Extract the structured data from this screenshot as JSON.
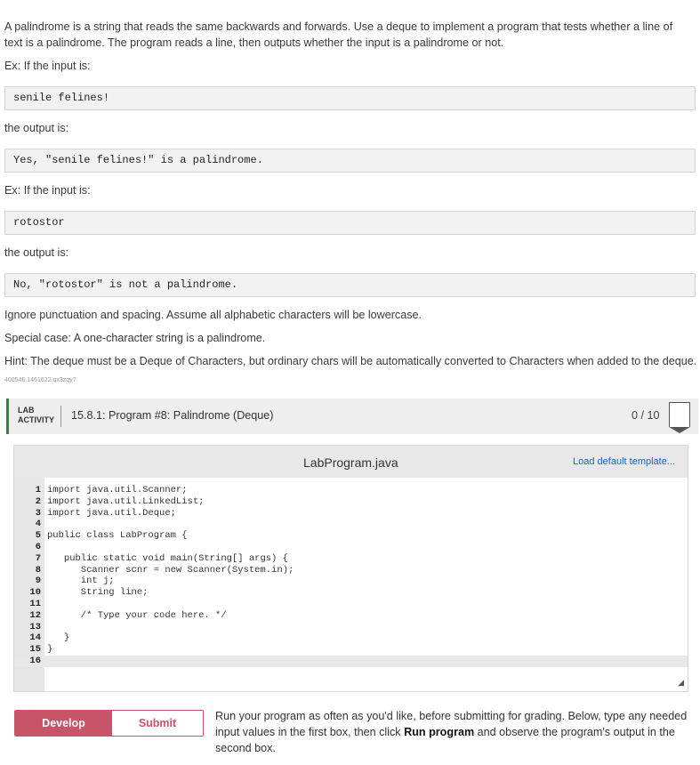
{
  "prompt": {
    "intro": "A palindrome is a string that reads the same backwards and forwards. Use a deque to implement a program that tests whether a line of text is a palindrome. The program reads a line, then outputs whether the input is a palindrome or not.",
    "ex1_label": "Ex: If the input is:",
    "ex1_input": "senile felines!",
    "output_label_1": "the output is:",
    "ex1_output": "Yes, \"senile felines!\" is a palindrome.",
    "ex2_label": "Ex: If the input is:",
    "ex2_input": "rotostor",
    "output_label_2": "the output is:",
    "ex2_output": "No, \"rotostor\" is not a palindrome.",
    "note1": "Ignore punctuation and spacing. Assume all alphabetic characters will be lowercase.",
    "note2": "Special case: A one-character string is a palindrome.",
    "hint": "Hint: The deque must be a Deque of Characters, but ordinary chars will be automatically converted to Characters when added to the deque.",
    "tracking_id": "400546.1461622.qx3zqy7"
  },
  "lab": {
    "tag": "LAB ACTIVITY",
    "title": "15.8.1: Program #8: Palindrome (Deque)",
    "score": "0 / 10"
  },
  "editor": {
    "file_name": "LabProgram.java",
    "load_template": "Load default template...",
    "lines": [
      {
        "n": "1",
        "code": "import java.util.Scanner;"
      },
      {
        "n": "2",
        "code": "import java.util.LinkedList;"
      },
      {
        "n": "3",
        "code": "import java.util.Deque;"
      },
      {
        "n": "4",
        "code": ""
      },
      {
        "n": "5",
        "code": "public class LabProgram {"
      },
      {
        "n": "6",
        "code": ""
      },
      {
        "n": "7",
        "code": "   public static void main(String[] args) {"
      },
      {
        "n": "8",
        "code": "      Scanner scnr = new Scanner(System.in);"
      },
      {
        "n": "9",
        "code": "      int j;"
      },
      {
        "n": "10",
        "code": "      String line;"
      },
      {
        "n": "11",
        "code": ""
      },
      {
        "n": "12",
        "code": "      /* Type your code here. */"
      },
      {
        "n": "13",
        "code": ""
      },
      {
        "n": "14",
        "code": "   }"
      },
      {
        "n": "15",
        "code": "}"
      },
      {
        "n": "16",
        "code": ""
      }
    ]
  },
  "modes": {
    "develop": "Develop mode",
    "submit": "Submit mode",
    "description_part1": "Run your program as often as you'd like, before submitting for grading. Below, type any needed input values in the first box, then click ",
    "description_bold": "Run program",
    "description_part2": " and observe the program's output in the second box."
  },
  "colors": {
    "accent_green": "#1e8e3e",
    "mode_red": "#c8546a",
    "link_blue": "#1565c0"
  }
}
